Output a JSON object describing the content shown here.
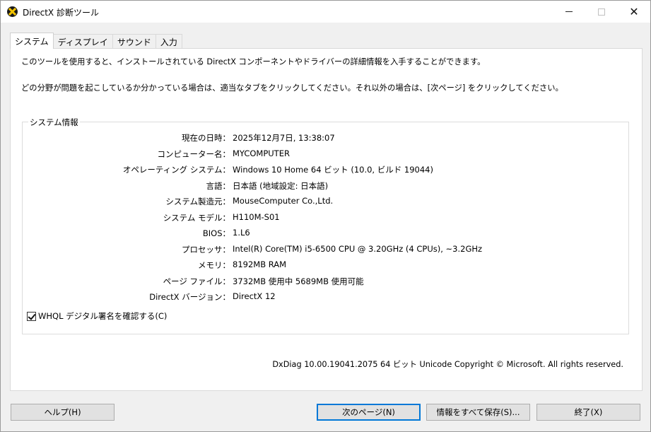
{
  "window": {
    "title": "DirectX 診断ツール",
    "close_glyph": "✕"
  },
  "tabs": [
    {
      "label": "システム"
    },
    {
      "label": "ディスプレイ"
    },
    {
      "label": "サウンド"
    },
    {
      "label": "入力"
    }
  ],
  "intro": {
    "line1": "このツールを使用すると、インストールされている DirectX コンポーネントやドライバーの詳細情報を入手することができます。",
    "line2": "どの分野が問題を起こしているか分かっている場合は、適当なタブをクリックしてください。それ以外の場合は、[次ページ] をクリックしてください。"
  },
  "system_info": {
    "legend": "システム情報",
    "rows": [
      {
        "label": "現在の日時：",
        "value": "2025年12月7日, 13:38:07"
      },
      {
        "label": "コンピューター名：",
        "value": "MYCOMPUTER"
      },
      {
        "label": "オペレーティング システム：",
        "value": "Windows 10 Home 64 ビット (10.0, ビルド 19044)"
      },
      {
        "label": "言語：",
        "value": "日本語 (地域設定: 日本語)"
      },
      {
        "label": "システム製造元：",
        "value": "MouseComputer Co.,Ltd."
      },
      {
        "label": "システム モデル：",
        "value": "H110M-S01"
      },
      {
        "label": "BIOS：",
        "value": "1.L6"
      },
      {
        "label": "プロセッサ：",
        "value": "Intel(R) Core(TM) i5-6500 CPU @ 3.20GHz (4 CPUs), ~3.2GHz"
      },
      {
        "label": "メモリ：",
        "value": "8192MB RAM"
      },
      {
        "label": "ページ ファイル：",
        "value": "3732MB 使用中 5689MB 使用可能"
      },
      {
        "label": "DirectX バージョン：",
        "value": "DirectX 12"
      }
    ],
    "whql_label": "WHQL デジタル署名を確認する(C)",
    "whql_checked": true
  },
  "footer": {
    "version_text": "DxDiag 10.00.19041.2075 64 ビット Unicode  Copyright © Microsoft. All rights reserved."
  },
  "buttons": {
    "help": "ヘルプ(H)",
    "next": "次のページ(N)",
    "save": "情報をすべて保存(S)...",
    "exit": "終了(X)"
  }
}
